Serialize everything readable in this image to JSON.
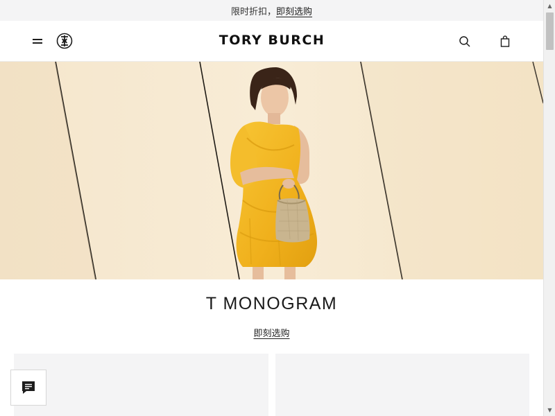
{
  "promo_bar": {
    "text": "限时折扣，",
    "cta": "即刻选购"
  },
  "header": {
    "brand": "TORY BURCH",
    "icons": [
      "menu-icon",
      "tory-burch-logo-icon",
      "search-icon",
      "shopping-bag-icon"
    ]
  },
  "hero": {
    "dress_color": "#f2b51d",
    "background_color": "#f6e8cf"
  },
  "section": {
    "title": "T MONOGRAM",
    "cta": "即刻选购"
  },
  "chat": {
    "icon": "chat-icon"
  },
  "scrollbar": {
    "up_icon": "scroll-up-arrow-icon",
    "down_icon": "scroll-down-arrow-icon"
  }
}
